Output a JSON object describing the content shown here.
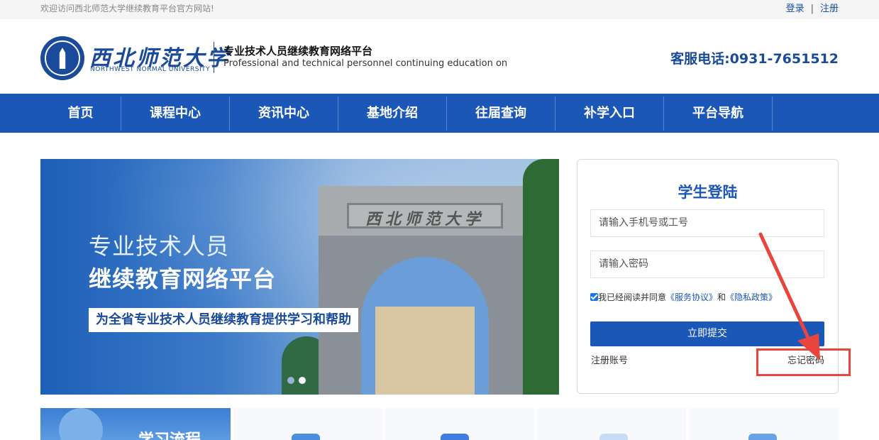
{
  "topbar": {
    "welcome": "欢迎访问西北师范大学继续教育平台官方网站!",
    "login": "登录",
    "separator": "|",
    "register": "注册"
  },
  "header": {
    "logo_cn": "西北师范大学",
    "logo_en": "NORTHWEST NORMAL UNIVERSITY",
    "platform_cn": "专业技术人员继续教育网络平台",
    "platform_en": "Professional and technical personnel continuing education onlin",
    "hotline": "客服电话:0931-7651512"
  },
  "nav": {
    "items": [
      "首页",
      "课程中心",
      "资讯中心",
      "基地介绍",
      "往届查询",
      "补学入口",
      "平台导航"
    ]
  },
  "banner": {
    "line1": "专业技术人员",
    "line2": "继续教育网络平台",
    "tagline": "为全省专业技术人员继续教育提供学习和帮助",
    "gate_plaque": "西北师范大学",
    "slide_count": 2,
    "active_slide": 2
  },
  "login": {
    "title": "学生登陆",
    "username_placeholder": "请输入手机号或工号",
    "password_placeholder": "请输入密码",
    "agree_prefix": "我已经阅读并同意",
    "service_link": "《服务协议》",
    "and": "和",
    "privacy_link": "《隐私政策》",
    "agree_checked": true,
    "submit": "立即提交",
    "register": "注册账号",
    "forgot": "忘记密码"
  },
  "steps": {
    "title": "学习流程"
  },
  "colors": {
    "brand_blue": "#1b57b7",
    "annotation_red": "#e8453f"
  }
}
